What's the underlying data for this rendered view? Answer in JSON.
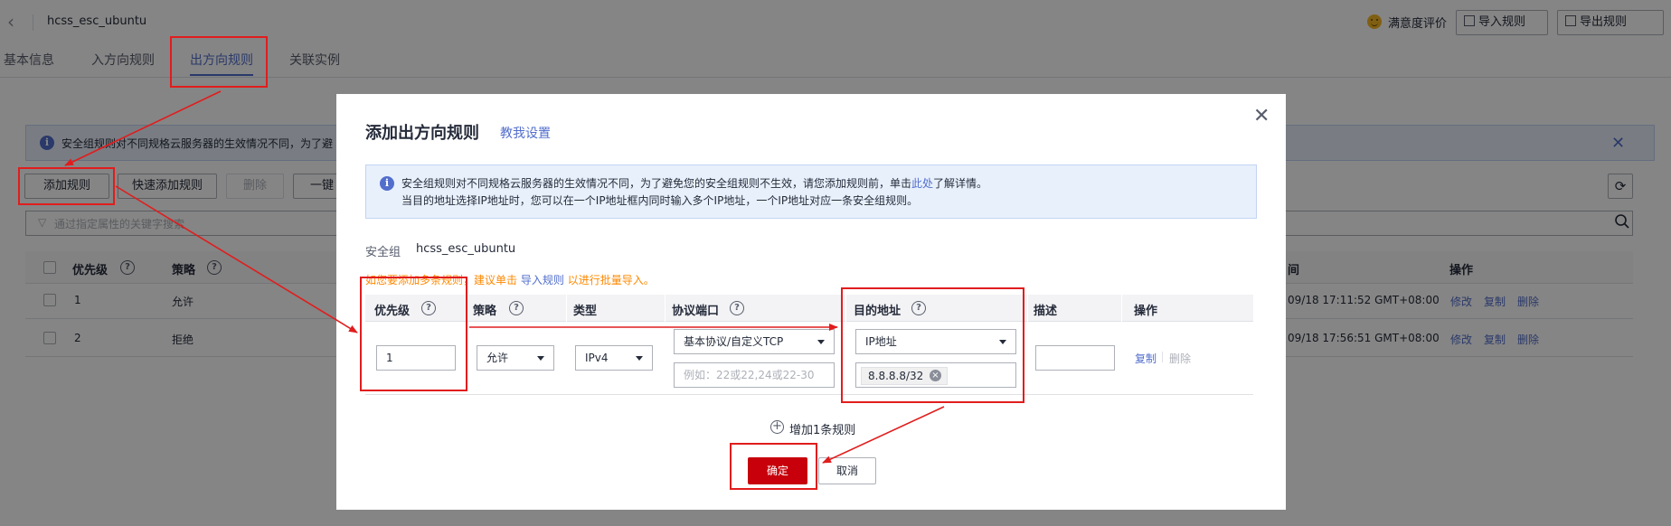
{
  "header": {
    "title": "hcss_esc_ubuntu",
    "rating_label": "满意度评价",
    "import_label": "导入规则",
    "export_label": "导出规则"
  },
  "tabs": [
    {
      "label": "基本信息"
    },
    {
      "label": "入方向规则"
    },
    {
      "label": "出方向规则",
      "active": true
    },
    {
      "label": "关联实例"
    }
  ],
  "background": {
    "info_text": "安全组规则对不同规格云服务器的生效情况不同，为了避",
    "toolbar": {
      "add_rule": "添加规则",
      "quick_add": "快速添加规则",
      "delete": "删除",
      "one_key": "一键"
    },
    "search_placeholder": "通过指定属性的关键字搜索",
    "table": {
      "headers": {
        "priority": "优先级",
        "policy": "策略",
        "time": "间",
        "ops": "操作"
      },
      "rows": [
        {
          "priority": "1",
          "policy": "允许",
          "time": "09/18 17:11:52 GMT+08:00",
          "ops": [
            "修改",
            "复制",
            "删除"
          ]
        },
        {
          "priority": "2",
          "policy": "拒绝",
          "time": "09/18 17:56:51 GMT+08:00",
          "ops": [
            "修改",
            "复制",
            "删除"
          ]
        }
      ]
    }
  },
  "dialog": {
    "title": "添加出方向规则",
    "help_link": "教我设置",
    "tip_line1_a": "安全组规则对不同规格云服务器的生效情况不同，为了避免您的安全组规则不生效，请您添加规则前，单击",
    "tip_line1_link": "此处",
    "tip_line1_b": "了解详情。",
    "tip_line2": "当目的地址选择IP地址时，您可以在一个IP地址框内同时输入多个IP地址，一个IP地址对应一条安全组规则。",
    "sg_label": "安全组",
    "sg_value": "hcss_esc_ubuntu",
    "batch_tip_a": "如您要添加多条规则，建议单击",
    "batch_tip_link": "导入规则",
    "batch_tip_b": "以进行批量导入。",
    "columns": {
      "priority": "优先级",
      "policy": "策略",
      "type": "类型",
      "port": "协议端口",
      "dest": "目的地址",
      "desc": "描述",
      "ops": "操作"
    },
    "row": {
      "priority": "1",
      "policy": "允许",
      "type": "IPv4",
      "protocol": "基本协议/自定义TCP",
      "port_placeholder": "例如：22或22,24或22-30",
      "dest_type": "IP地址",
      "dest_ip": "8.8.8.8/32",
      "copy": "复制",
      "delete": "删除"
    },
    "add_one": "增加1条规则",
    "confirm": "确定",
    "cancel": "取消"
  },
  "colors": {
    "accent": "#526ecc",
    "primary_button": "#c7000b",
    "annotation_red": "#e11d1d",
    "warning_text": "#ff8800"
  }
}
